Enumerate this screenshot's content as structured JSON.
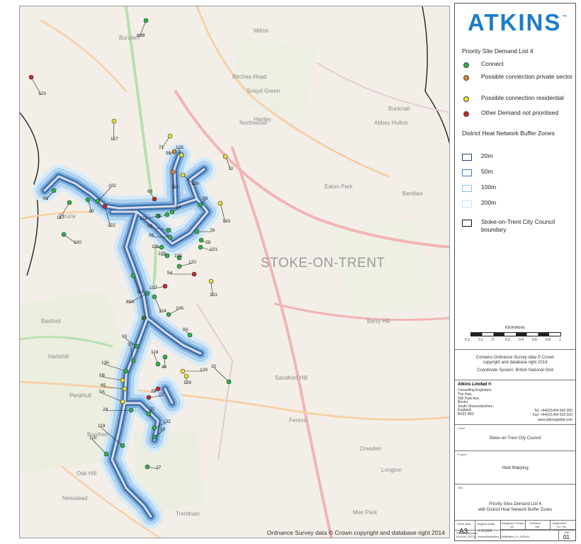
{
  "map": {
    "city_label": "STOKE-ON-TRENT",
    "copyright": "Ordnance Survey data © Crown copyright and database right 2014",
    "places": [
      "Burslem",
      "Hanley",
      "Bucknall",
      "Fenton",
      "Etruria",
      "Birches Head",
      "Sneyd Green",
      "Abbey Hulton",
      "Northwood",
      "Eaton Park",
      "Basford",
      "Hartshill",
      "Penkhull",
      "Boothen",
      "Oak Hill",
      "Trentham",
      "Dresden",
      "Meir Park",
      "Milton",
      "Bentilee",
      "Berry Hill",
      "Sandford Hill",
      "Longton",
      "Newstead"
    ],
    "sites": [
      "80B",
      "123",
      "127",
      "71",
      "95",
      "125",
      "72",
      "112",
      "126",
      "102",
      "91",
      "117",
      "87",
      "68",
      "99",
      "93",
      "121",
      "74",
      "122",
      "133",
      "94",
      "76",
      "96",
      "78",
      "100",
      "116",
      "101",
      "109",
      "105",
      "120",
      "54",
      "111",
      "107",
      "131",
      "80A",
      "124",
      "106",
      "80",
      "8A",
      "90",
      "30",
      "118",
      "44",
      "32",
      "130",
      "129",
      "5B",
      "128",
      "65",
      "5A",
      "25",
      "22",
      "24",
      "21",
      "132",
      "28",
      "119",
      "110",
      "37"
    ],
    "colors": {
      "connect": "#2db34a",
      "private": "#d4892a",
      "residential": "#e8e030",
      "other": "#c62828",
      "buffer": "#2f6fb8"
    }
  },
  "legend": {
    "company": "ATKINS",
    "trademark": "™",
    "demand_title": "Priority Site Demand List 4",
    "demand_items": [
      {
        "label": "Connect",
        "color": "#2db34a"
      },
      {
        "label": "Possible connection private sector",
        "color": "#d4892a"
      },
      {
        "label": "Possible connection residential",
        "color": "#e8e030"
      },
      {
        "label": "Other Demand not prioritised",
        "color": "#c62828"
      }
    ],
    "buffer_title": "District Heat Network Buffer Zones",
    "buffer_items": [
      {
        "label": "20m",
        "color": "#1f3f7a"
      },
      {
        "label": "50m",
        "color": "#3d7fcf"
      },
      {
        "label": "100m",
        "color": "#8ec0ea"
      },
      {
        "label": "200m",
        "color": "#c9e2f6"
      }
    ],
    "boundary_label": "Stoke-on-Trent City Council boundary"
  },
  "title_block": {
    "scale_label": "Kilometres",
    "scale_ticks": [
      "0.2",
      "0.1",
      "0",
      "0.2",
      "0.4",
      "0.6",
      "0.8",
      "1"
    ],
    "copyright_line1": "Contains Ordnance Survey data © Crown",
    "copyright_line2": "copyright and database right 2014",
    "coord_system": "Coordinate System: British National Grid",
    "company_name": "Atkins Limited ®",
    "company_sub": "Consulting Engineers",
    "address": [
      "The Hub,",
      "500 Park Ave,",
      "Bristol,",
      "South Gloucestershire,",
      "England,",
      "BS32 4RZ"
    ],
    "tel": "Tel: +44(0)1454 662 000",
    "fax": "Fax: +44(0)1454 663 333",
    "web": "www.atkinsglobal.com",
    "client_cap": "Client",
    "client": "Stoke-on-Trent City Council",
    "project_cap": "Project",
    "project": "Heat Mapping",
    "title_cap": "Title",
    "title_line1": "Priority Sites Demand List 4",
    "title_line2": "with District Heat Network Buffer Zones",
    "sheet_size_cap": "Sheet Size",
    "sheet_size": "A3",
    "scale_cap": "Original Scale",
    "scale": "1:25,000",
    "designed_cap": "Designed / Drawn",
    "designed": "JS",
    "checked_cap": "Checked",
    "checked": "HM",
    "authorised_cap": "Authorised",
    "authorised": "SJ / HL",
    "drawing_cap": "Drawing Number",
    "drawing_no": "5014140_SoTCC_PrioritySitesBuffers_DHNBuffers_01_GIS0010",
    "rev_cap": "Rev",
    "rev": "01"
  }
}
